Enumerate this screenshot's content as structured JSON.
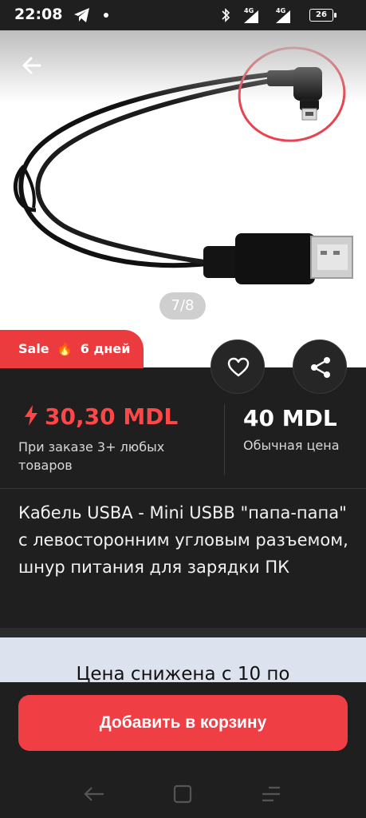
{
  "status_bar": {
    "time": "22:08",
    "network_1": "4G",
    "network_2": "4G",
    "battery": "26"
  },
  "gallery": {
    "page_indicator": "7/8"
  },
  "sale_badge": {
    "label": "Sale",
    "icon": "fire-icon",
    "duration": "6 дней"
  },
  "price": {
    "current": "30,30 MDL",
    "current_note": "При заказе 3+ любых товаров",
    "regular": "40 MDL",
    "regular_note": "Обычная цена",
    "accent_color": "#ff4747"
  },
  "product": {
    "title": "Кабель USBA - Mini USBB \"папа-папа\" с левосторонним угловым разъемом, шнур питания для зарядки ПК"
  },
  "promo": {
    "text": "Цена снижена с 10 по"
  },
  "cart": {
    "button_label": "Добавить в корзину",
    "button_color": "#ef3e44"
  }
}
